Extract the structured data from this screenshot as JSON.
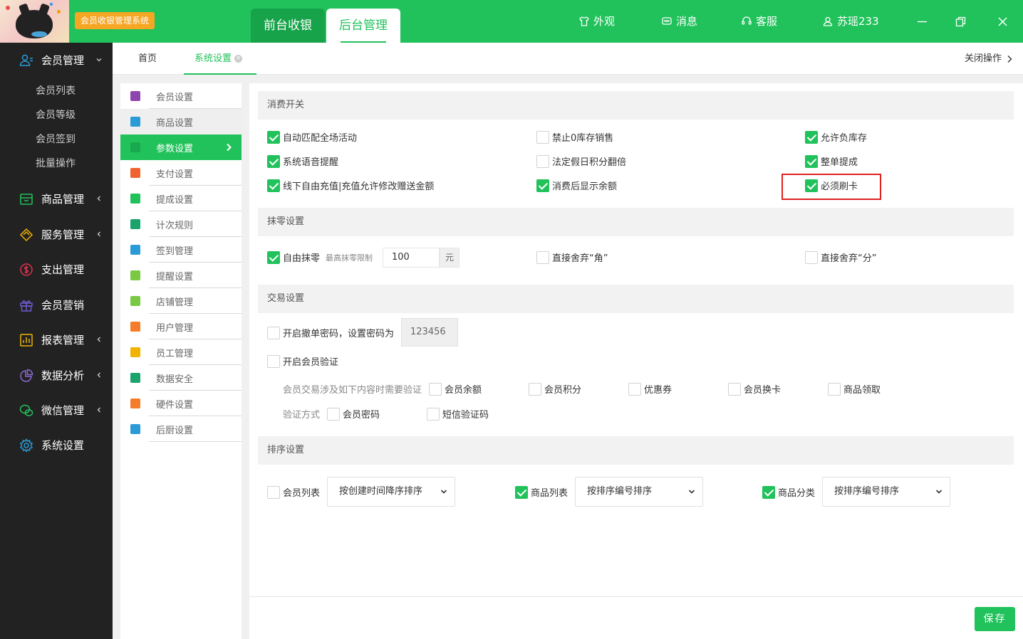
{
  "header": {
    "app_badge": "会员收银管理系统",
    "tabs": [
      {
        "label": "前台收银"
      },
      {
        "label": "后台管理"
      }
    ],
    "actions": [
      {
        "label": "外观",
        "icon": "shirt-icon"
      },
      {
        "label": "消息",
        "icon": "message-icon"
      },
      {
        "label": "客服",
        "icon": "headset-icon"
      },
      {
        "label": "苏瑶233",
        "icon": "user-icon"
      }
    ]
  },
  "sidebar": {
    "groups": [
      {
        "label": "会员管理",
        "icon": "member-icon",
        "expanded": true,
        "items": [
          "会员列表",
          "会员等级",
          "会员签到",
          "批量操作"
        ]
      },
      {
        "label": "商品管理",
        "icon": "goods-icon"
      },
      {
        "label": "服务管理",
        "icon": "service-icon"
      },
      {
        "label": "支出管理",
        "icon": "expense-icon"
      },
      {
        "label": "会员营销",
        "icon": "gift-icon"
      },
      {
        "label": "报表管理",
        "icon": "report-icon"
      },
      {
        "label": "数据分析",
        "icon": "pie-chart-icon"
      },
      {
        "label": "微信管理",
        "icon": "wechat-icon"
      },
      {
        "label": "系统设置",
        "icon": "gear-icon"
      }
    ]
  },
  "tabstrip": {
    "home": "首页",
    "active": "系统设置",
    "close_ops": "关闭操作"
  },
  "settings_nav": [
    {
      "label": "会员设置",
      "color": "#8e44ad"
    },
    {
      "label": "商品设置",
      "color": "#2a9bd6"
    },
    {
      "label": "参数设置",
      "color": "#21c25b"
    },
    {
      "label": "支付设置",
      "color": "#f0632f"
    },
    {
      "label": "提成设置",
      "color": "#21c25b"
    },
    {
      "label": "计次规则",
      "color": "#1aa36a"
    },
    {
      "label": "签到管理",
      "color": "#2a9bd6"
    },
    {
      "label": "提醒设置",
      "color": "#7ac943"
    },
    {
      "label": "店铺管理",
      "color": "#7ac943"
    },
    {
      "label": "用户管理",
      "color": "#f57c2a"
    },
    {
      "label": "员工管理",
      "color": "#f0b400"
    },
    {
      "label": "数据安全",
      "color": "#1aa36a"
    },
    {
      "label": "硬件设置",
      "color": "#f57c2a"
    },
    {
      "label": "后厨设置",
      "color": "#2a9bd6"
    }
  ],
  "content": {
    "consume": {
      "title": "消费开关",
      "options": [
        {
          "label": "自动匹配全场活动",
          "checked": true
        },
        {
          "label": "禁止0库存销售",
          "checked": false
        },
        {
          "label": "允许负库存",
          "checked": true
        },
        {
          "label": "系统语音提醒",
          "checked": true
        },
        {
          "label": "法定假日积分翻倍",
          "checked": false
        },
        {
          "label": "整单提成",
          "checked": true
        },
        {
          "label": "线下自由充值|充值允许修改赠送金额",
          "checked": true
        },
        {
          "label": "消费后显示余额",
          "checked": true
        },
        {
          "label": "必须刷卡",
          "checked": true
        }
      ]
    },
    "rounding": {
      "title": "抹零设置",
      "free_label": "自由抹零",
      "free_checked": true,
      "limit_label": "最高抹零限制",
      "limit_value": "100",
      "unit": "元",
      "jiao_label": "直接舍弃“角”",
      "fen_label": "直接舍弃“分”"
    },
    "trade": {
      "title": "交易设置",
      "cancel_pwd_label": "开启撤单密码，设置密码为",
      "cancel_pwd_value": "123456",
      "verify_label": "开启会员验证",
      "involve_label": "会员交易涉及如下内容时需要验证",
      "involve_items": [
        "会员余额",
        "会员积分",
        "优惠券",
        "会员换卡",
        "商品领取"
      ],
      "method_label": "验证方式",
      "method_items": [
        "会员密码",
        "短信验证码"
      ]
    },
    "sort": {
      "title": "排序设置",
      "items": [
        {
          "label": "会员列表",
          "checked": false,
          "select": "按创建时间降序排序"
        },
        {
          "label": "商品列表",
          "checked": true,
          "select": "按排序编号排序"
        },
        {
          "label": "商品分类",
          "checked": true,
          "select": "按排序编号排序"
        }
      ]
    },
    "save_label": "保存"
  }
}
